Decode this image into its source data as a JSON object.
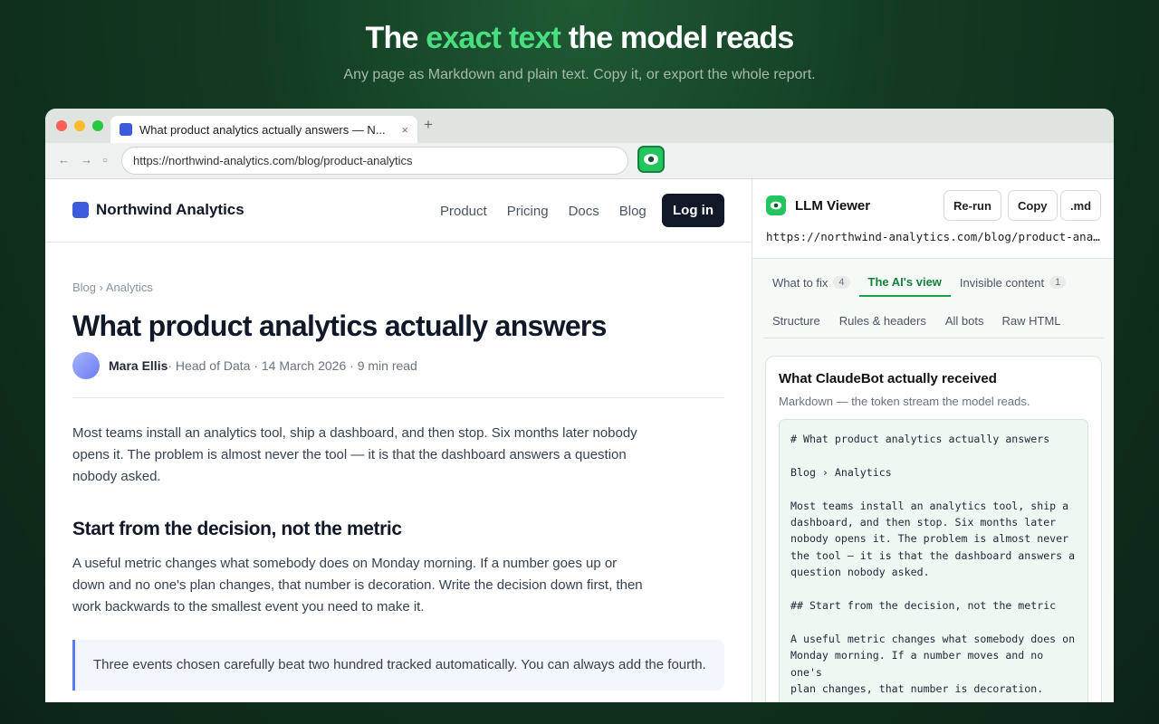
{
  "hero": {
    "title_pre": "The ",
    "title_accent": "exact text",
    "title_post": " the model reads",
    "subtitle": "Any page as Markdown and plain text. Copy it, or export the whole report."
  },
  "colors": {
    "accent": "#4ade80",
    "brand": "#22c55e",
    "site_brand": "#3b5bdb"
  },
  "browser": {
    "tab_title": "What product analytics actually answers — N...",
    "tab_close": "×",
    "new_tab": "+",
    "back": "←",
    "forward": "→",
    "reload": "○",
    "url": "https://northwind-analytics.com/blog/product-analytics",
    "extension_icon": "eye-icon"
  },
  "site": {
    "brand": "Northwind Analytics",
    "nav": [
      "Product",
      "Pricing",
      "Docs",
      "Blog"
    ],
    "login": "Log in"
  },
  "article": {
    "breadcrumb": "Blog › Analytics",
    "title": "What product analytics actually answers",
    "author": "Mara Ellis",
    "meta": " · Head of Data · 14 March 2026 · 9 min read",
    "p1": "Most teams install an analytics tool, ship a dashboard, and then stop. Six months later nobody opens it. The problem is almost never the tool — it is that the dashboard answers a question nobody asked.",
    "h2": "Start from the decision, not the metric",
    "p2": "A useful metric changes what somebody does on Monday morning. If a number goes up or down and no one's plan changes, that number is decoration. Write the decision down first, then work backwards to the smallest event you need to make it.",
    "quote": "Three events chosen carefully beat two hundred tracked automatically. You can always add the fourth."
  },
  "panel": {
    "title": "LLM Viewer",
    "buttons": {
      "rerun": "Re-run",
      "copy": "Copy",
      "md": ".md"
    },
    "url": "https://northwind-analytics.com/blog/product-analytics",
    "tabs_row1": [
      {
        "label": "What to fix",
        "badge": "4"
      },
      {
        "label": "The AI's view",
        "badge": ""
      },
      {
        "label": "Invisible content",
        "badge": "1"
      }
    ],
    "tabs_row2": [
      "Structure",
      "Rules & headers",
      "All bots",
      "Raw HTML"
    ],
    "card_title": "What ClaudeBot actually received",
    "card_subtitle": "Markdown — the token stream the model reads.",
    "markdown_lines": [
      "# What product analytics actually answers",
      "",
      "Blog › Analytics",
      "",
      "Most teams install an analytics tool, ship a",
      "dashboard, and then stop. Six months later",
      "nobody opens it. The problem is almost never",
      "the tool — it is that the dashboard answers a",
      "question nobody asked.",
      "",
      "## Start from the decision, not the metric",
      "",
      "A useful metric changes what somebody does on",
      "Monday morning. If a number moves and no one's",
      "plan changes, that number is decoration.",
      "",
      ""
    ]
  }
}
